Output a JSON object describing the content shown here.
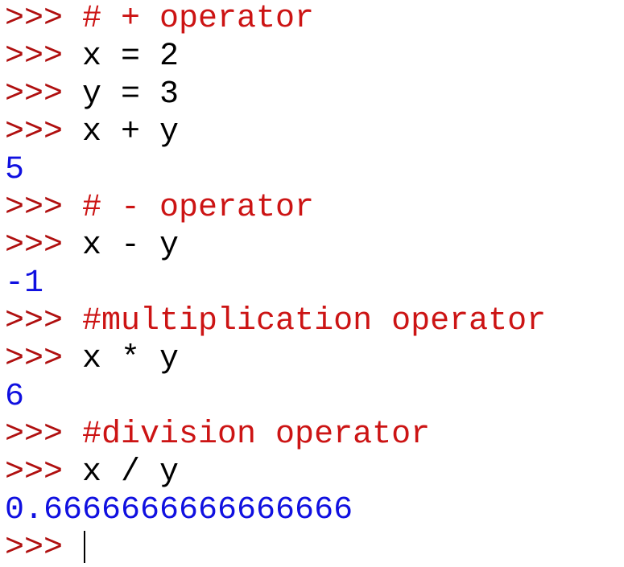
{
  "shell": {
    "prompt": ">>> ",
    "lines": [
      {
        "kind": "comment",
        "text": "# + operator"
      },
      {
        "kind": "code",
        "text": "x = 2"
      },
      {
        "kind": "code",
        "text": "y = 3"
      },
      {
        "kind": "code",
        "text": "x + y"
      },
      {
        "kind": "output",
        "text": "5"
      },
      {
        "kind": "comment",
        "text": "# - operator"
      },
      {
        "kind": "code",
        "text": "x - y"
      },
      {
        "kind": "output",
        "text": "-1"
      },
      {
        "kind": "comment",
        "text": "#multiplication operator"
      },
      {
        "kind": "code",
        "text": "x * y"
      },
      {
        "kind": "output",
        "text": "6"
      },
      {
        "kind": "comment",
        "text": "#division operator"
      },
      {
        "kind": "code",
        "text": "x / y"
      },
      {
        "kind": "output",
        "text": "0.6666666666666666"
      }
    ]
  },
  "colors": {
    "prompt": "#b01010",
    "comment": "#cc1414",
    "code": "#000000",
    "output": "#1010e0"
  }
}
